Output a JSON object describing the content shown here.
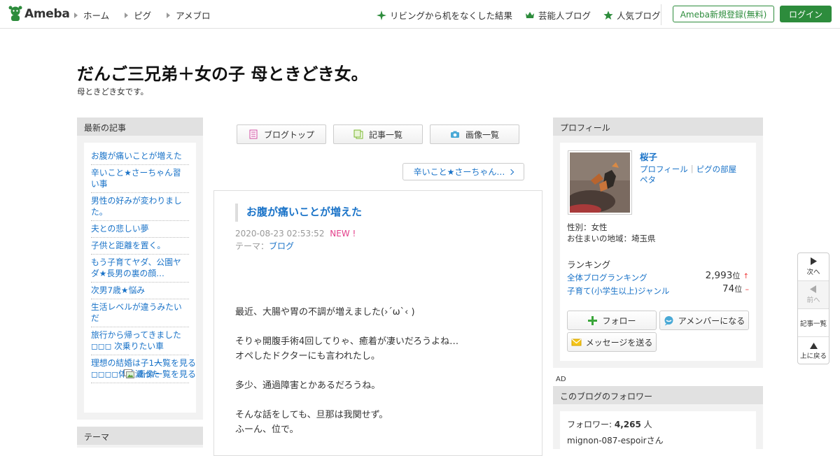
{
  "header": {
    "logo_text": "Ameba",
    "nav_left": [
      "ホーム",
      "ピグ",
      "アメブロ"
    ],
    "nav_right": [
      {
        "icon": "sparkle-icon",
        "label": "リビングから机をなくした結果"
      },
      {
        "icon": "crown-icon",
        "label": "芸能人ブログ"
      },
      {
        "icon": "star-icon",
        "label": "人気ブログ"
      }
    ],
    "register_label": "Ameba新規登録(無料)",
    "login_label": "ログイン",
    "accent_color": "#2d8c3c"
  },
  "blog": {
    "title": "だんご三兄弟＋女の子 母ときどき女。",
    "description": "母ときどき女です。"
  },
  "left_sidebar": {
    "recent_title": "最新の記事",
    "recent_items": [
      "お腹が痛いことが増えた",
      "辛いこと★さーちゃん習い事",
      "男性の好みが変わりました。",
      "夫との悲しい夢",
      "子供と距離を置く。",
      "もう子育てヤダ、公園ヤダ★長男の裏の顔…",
      "次男7歳★悩み",
      "生活レベルが違うみたいだ",
      "旅行から帰ってきました ◻◻◻ 次乗りたい車",
      "理想の結婚は子1人◻◻◻◻体重減った"
    ],
    "see_list": "一覧を見る",
    "see_images": "画像一覧を見る",
    "theme_title": "テーマ"
  },
  "center": {
    "tabs": [
      {
        "icon": "blog-top-icon",
        "label": "ブログトップ"
      },
      {
        "icon": "article-list-icon",
        "label": "記事一覧"
      },
      {
        "icon": "camera-icon",
        "label": "画像一覧"
      }
    ],
    "next_article": "辛いこと★さーちゃん…",
    "article": {
      "title": "お腹が痛いことが増えた",
      "date": "2020-08-23 02:53:52",
      "new_badge": "NEW !",
      "theme_label": "テーマ：",
      "theme_link": "ブログ",
      "body": [
        "最近、大腸や胃の不調が増えました(›´ω`‹ )",
        "そりゃ開腹手術4回してりゃ、癒着が凄いだろうよね…\nオペしたドクターにも言われたし。",
        "多少、通過障害とかあるだろうね。",
        "そんな話をしても、旦那は我関せず。\nふーん、位で。"
      ]
    }
  },
  "right_sidebar": {
    "profile_title": "プロフィール",
    "name": "桜子",
    "links": [
      "プロフィール",
      "ピグの部屋"
    ],
    "peta": "ペタ",
    "gender": "性別：女性",
    "region": "お住まいの地域：埼玉県",
    "ranking_title": "ランキング",
    "rankings": [
      {
        "label": "全体ブログランキング",
        "value": "2,993",
        "unit": "位",
        "trend": "↑"
      },
      {
        "label": "子育て(小学生以上)ジャンル",
        "value": "74",
        "unit": "位",
        "trend": "–"
      }
    ],
    "follow_label": "フォロー",
    "amember_label": "アメンバーになる",
    "message_label": "メッセージを送る",
    "ad_label": "AD",
    "followers_title": "このブログのフォロワー",
    "followers_label": "フォロワー: ",
    "followers_count": "4,265",
    "followers_unit": " 人",
    "follower_name": "mignon-087-espoirさん"
  },
  "float_nav": {
    "next": "次へ",
    "prev": "前へ",
    "list": "記事一覧",
    "top": "上に戻る"
  }
}
